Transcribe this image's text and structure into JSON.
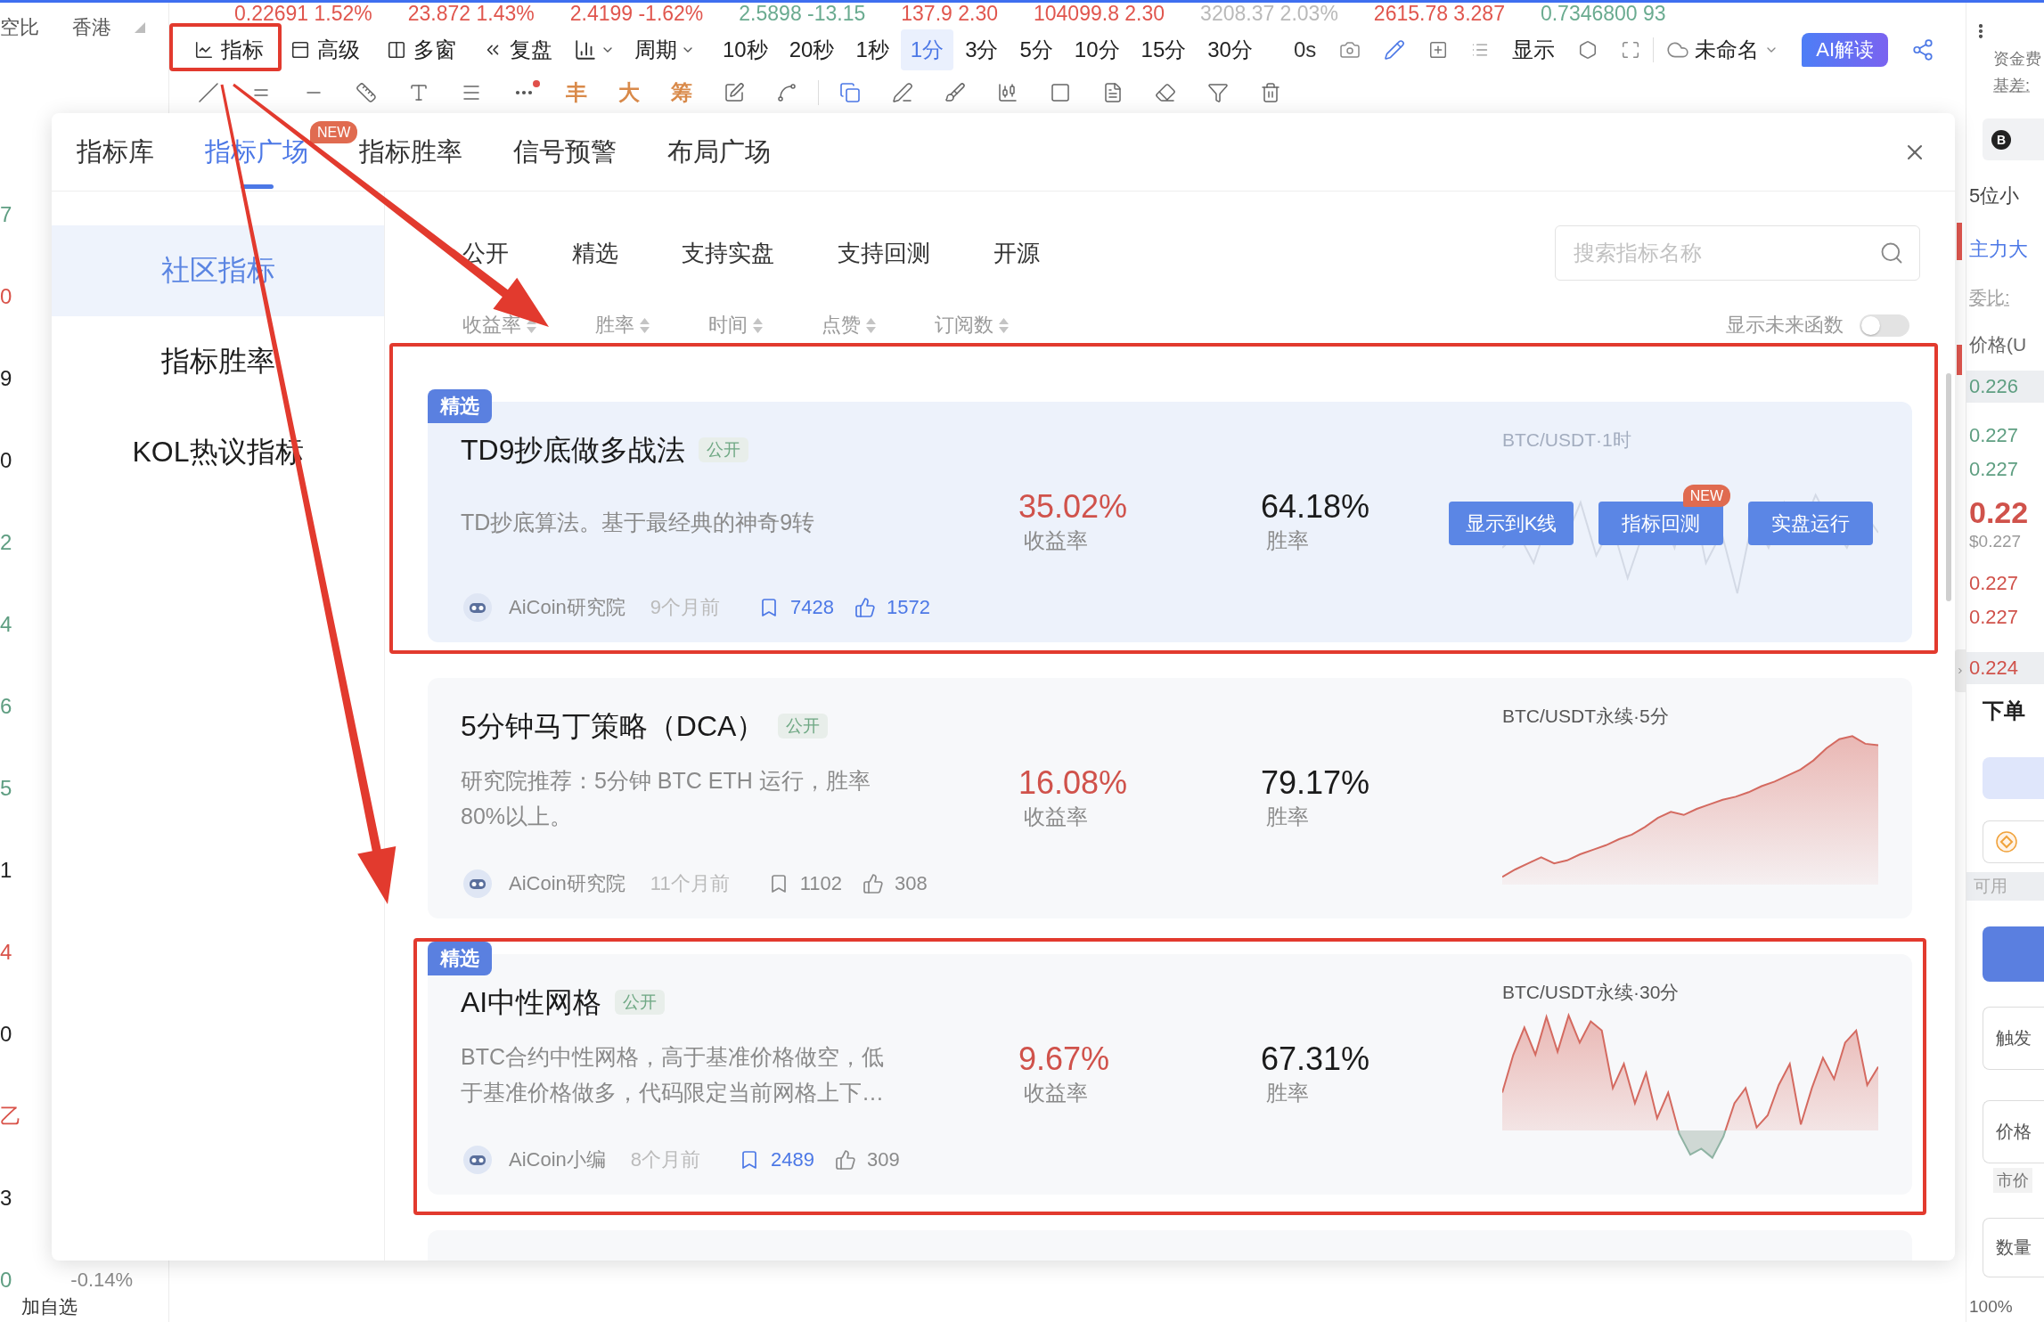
{
  "ticker": [
    {
      "text": "0.22691 1.52%",
      "color": "#e0564e"
    },
    {
      "text": "23.872 1.43%",
      "color": "#e0564e"
    },
    {
      "text": "2.4199 -1.62%",
      "color": "#e0564e"
    },
    {
      "text": "2.5898 -13.15",
      "color": "#6aab90"
    },
    {
      "text": "137.9 2.30",
      "color": "#e0564e"
    },
    {
      "text": "104099.8 2.30",
      "color": "#e0564e"
    },
    {
      "text": "3208.37 2.03%",
      "color": "#b9b9b9"
    },
    {
      "text": "2615.78 3.287",
      "color": "#e0564e"
    },
    {
      "text": "0.7346800 93",
      "color": "#6aab90"
    }
  ],
  "watchlist": {
    "header": [
      {
        "label": "空比"
      },
      {
        "label": "香港"
      }
    ],
    "rows": [
      {
        "text": "7",
        "color": "#5f9e82"
      },
      {
        "text": "0",
        "color": "#d9534a"
      },
      {
        "text": "9",
        "color": "#222222"
      },
      {
        "text": "0",
        "color": "#222222"
      },
      {
        "text": "2",
        "color": "#5f9e82"
      },
      {
        "text": "4",
        "color": "#5f9e82"
      },
      {
        "text": "6",
        "color": "#5f9e82"
      },
      {
        "text": "5",
        "color": "#5f9e82"
      },
      {
        "text": "1",
        "color": "#222222"
      },
      {
        "text": "4",
        "color": "#d9534a"
      },
      {
        "text": "0",
        "color": "#222222"
      },
      {
        "text": "乙",
        "color": "#d9534a"
      },
      {
        "text": "3",
        "color": "#222222"
      },
      {
        "text": "0",
        "color": "#5f9e82",
        "change": "-0.14%"
      }
    ],
    "add_label": "加自选"
  },
  "toolbar": {
    "tools": [
      {
        "label": "指标",
        "annotated": true
      },
      {
        "label": "高级",
        "annotated": false
      },
      {
        "label": "多窗",
        "annotated": false
      },
      {
        "label": "复盘",
        "annotated": false
      }
    ],
    "period": "周期",
    "intervals": [
      {
        "label": "10秒",
        "selected": false
      },
      {
        "label": "20秒",
        "selected": false
      },
      {
        "label": "1秒",
        "selected": false
      },
      {
        "label": "1分",
        "selected": true
      },
      {
        "label": "3分",
        "selected": false
      },
      {
        "label": "5分",
        "selected": false
      },
      {
        "label": "10分",
        "selected": false
      },
      {
        "label": "15分",
        "selected": false
      },
      {
        "label": "30分",
        "selected": false
      }
    ],
    "countdown": "0s",
    "display": "显示",
    "layout": "未命名",
    "ai_button": "AI解读"
  },
  "drawing_tools": {
    "glyphs": [
      {
        "label": "丰"
      },
      {
        "label": "大"
      },
      {
        "label": "筹"
      }
    ]
  },
  "modal": {
    "tabs": [
      {
        "label": "指标库",
        "selected": false
      },
      {
        "label": "指标广场",
        "selected": true,
        "badge": "NEW"
      },
      {
        "label": "指标胜率",
        "selected": false
      },
      {
        "label": "信号预警",
        "selected": false
      },
      {
        "label": "布局广场",
        "selected": false
      }
    ],
    "sidebar": [
      {
        "label": "社区指标",
        "selected": true
      },
      {
        "label": "指标胜率",
        "selected": false
      },
      {
        "label": "KOL热议指标",
        "selected": false
      }
    ],
    "filters": [
      {
        "label": "公开"
      },
      {
        "label": "精选"
      },
      {
        "label": "支持实盘"
      },
      {
        "label": "支持回测"
      },
      {
        "label": "开源"
      }
    ],
    "search": {
      "placeholder": "搜索指标名称"
    },
    "sorts": [
      {
        "label": "收益率"
      },
      {
        "label": "胜率"
      },
      {
        "label": "时间"
      },
      {
        "label": "点赞"
      },
      {
        "label": "订阅数"
      }
    ],
    "future_toggle": {
      "label": "显示未来函数",
      "on": false
    },
    "cards": [
      {
        "badge": "精选",
        "title": "TD9抄底做多战法",
        "tag": "公开",
        "description": "TD抄底算法。基于最经典的神奇9转",
        "stats": [
          {
            "kind": "return",
            "value": "35.02%",
            "label": "收益率"
          },
          {
            "kind": "win_rate",
            "value": "64.18%",
            "label": "胜率"
          }
        ],
        "author": "AiCoin研究院",
        "time": "9个月前",
        "subscribers": "7428",
        "subscribed": true,
        "likes": "1572",
        "liked": true,
        "chart": {
          "label": "BTC/USDT·1时",
          "kind": "jagged"
        },
        "hovered": true,
        "annotated": true,
        "actions": [
          {
            "label": "显示到K线"
          },
          {
            "label": "指标回测",
            "badge": "NEW"
          },
          {
            "label": "实盘运行"
          }
        ]
      },
      {
        "title": "5分钟马丁策略（DCA）",
        "tag": "公开",
        "description": "研究院推荐：5分钟 BTC ETH 运行，胜率80%以上。",
        "stats": [
          {
            "kind": "return",
            "value": "16.08%",
            "label": "收益率"
          },
          {
            "kind": "win_rate",
            "value": "79.17%",
            "label": "胜率"
          }
        ],
        "author": "AiCoin研究院",
        "time": "11个月前",
        "subscribers": "1102",
        "subscribed": false,
        "likes": "308",
        "liked": false,
        "chart": {
          "label": "BTC/USDT永续·5分",
          "kind": "rising"
        },
        "hovered": false,
        "annotated": false
      },
      {
        "badge": "精选",
        "title": "AI中性网格",
        "tag": "公开",
        "description": "BTC合约中性网格，高于基准价格做空，低于基准价格做多，代码限定当前网格上下…",
        "stats": [
          {
            "kind": "return",
            "value": "9.67%",
            "label": "收益率"
          },
          {
            "kind": "win_rate",
            "value": "67.31%",
            "label": "胜率"
          }
        ],
        "author": "AiCoin小编",
        "time": "8个月前",
        "subscribers": "2489",
        "subscribed": true,
        "likes": "309",
        "liked": false,
        "chart": {
          "label": "BTC/USDT永续·30分",
          "kind": "choppy"
        },
        "hovered": false,
        "annotated": true
      }
    ]
  },
  "right_panel": {
    "info": [
      {
        "label": "资金费"
      },
      {
        "label": "基差:"
      }
    ],
    "coin_symbol": "B",
    "precision": "5位小",
    "link": "主力大",
    "ratio": "委比:",
    "price_header": "价格(U",
    "upper_rows": [
      {
        "price": "0.226",
        "highlighted": true
      },
      {
        "price": "0.227",
        "highlighted": false
      },
      {
        "price": "0.227",
        "highlighted": false
      }
    ],
    "last_price": "0.22",
    "last_price_usd": "$0.227",
    "lower_rows": [
      {
        "price": "0.227",
        "highlighted": false
      },
      {
        "price": "0.227",
        "highlighted": false
      },
      {
        "price": "0.224",
        "highlighted": true
      }
    ],
    "order_title": "下单",
    "available": "可用",
    "fields": [
      {
        "placeholder": "触发"
      },
      {
        "placeholder": "价格"
      }
    ],
    "order_type": "市价",
    "quantity": {
      "placeholder": "数量"
    },
    "percent": "100%"
  }
}
